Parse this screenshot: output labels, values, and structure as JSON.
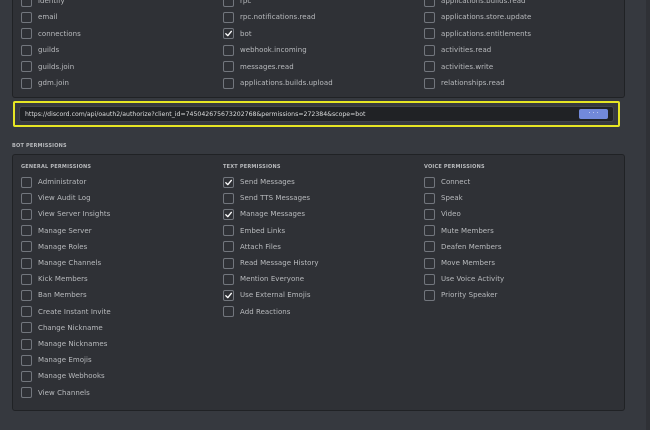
{
  "scopes": {
    "col1": [
      {
        "label": "identify",
        "checked": false
      },
      {
        "label": "email",
        "checked": false
      },
      {
        "label": "connections",
        "checked": false
      },
      {
        "label": "guilds",
        "checked": false
      },
      {
        "label": "guilds.join",
        "checked": false
      },
      {
        "label": "gdm.join",
        "checked": false
      }
    ],
    "col2": [
      {
        "label": "rpc",
        "checked": false
      },
      {
        "label": "rpc.notifications.read",
        "checked": false
      },
      {
        "label": "bot",
        "checked": true
      },
      {
        "label": "webhook.incoming",
        "checked": false
      },
      {
        "label": "messages.read",
        "checked": false
      },
      {
        "label": "applications.builds.upload",
        "checked": false
      }
    ],
    "col3": [
      {
        "label": "applications.builds.read",
        "checked": false
      },
      {
        "label": "applications.store.update",
        "checked": false
      },
      {
        "label": "applications.entitlements",
        "checked": false
      },
      {
        "label": "activities.read",
        "checked": false
      },
      {
        "label": "activities.write",
        "checked": false
      },
      {
        "label": "relationships.read",
        "checked": false
      }
    ]
  },
  "url": {
    "value": "https://discord.com/api/oauth2/authorize?client_id=745042675673202768&permissions=272384&scope=bot",
    "copy_label": "· · ·"
  },
  "bot_permissions": {
    "title": "BOT PERMISSIONS",
    "general": {
      "heading": "GENERAL PERMISSIONS",
      "items": [
        {
          "label": "Administrator",
          "checked": false
        },
        {
          "label": "View Audit Log",
          "checked": false
        },
        {
          "label": "View Server Insights",
          "checked": false
        },
        {
          "label": "Manage Server",
          "checked": false
        },
        {
          "label": "Manage Roles",
          "checked": false
        },
        {
          "label": "Manage Channels",
          "checked": false
        },
        {
          "label": "Kick Members",
          "checked": false
        },
        {
          "label": "Ban Members",
          "checked": false
        },
        {
          "label": "Create Instant Invite",
          "checked": false
        },
        {
          "label": "Change Nickname",
          "checked": false
        },
        {
          "label": "Manage Nicknames",
          "checked": false
        },
        {
          "label": "Manage Emojis",
          "checked": false
        },
        {
          "label": "Manage Webhooks",
          "checked": false
        },
        {
          "label": "View Channels",
          "checked": false
        }
      ]
    },
    "text": {
      "heading": "TEXT PERMISSIONS",
      "items": [
        {
          "label": "Send Messages",
          "checked": true
        },
        {
          "label": "Send TTS Messages",
          "checked": false
        },
        {
          "label": "Manage Messages",
          "checked": true
        },
        {
          "label": "Embed Links",
          "checked": false
        },
        {
          "label": "Attach Files",
          "checked": false
        },
        {
          "label": "Read Message History",
          "checked": false
        },
        {
          "label": "Mention Everyone",
          "checked": false
        },
        {
          "label": "Use External Emojis",
          "checked": true
        },
        {
          "label": "Add Reactions",
          "checked": false
        }
      ]
    },
    "voice": {
      "heading": "VOICE PERMISSIONS",
      "items": [
        {
          "label": "Connect",
          "checked": false
        },
        {
          "label": "Speak",
          "checked": false
        },
        {
          "label": "Video",
          "checked": false
        },
        {
          "label": "Mute Members",
          "checked": false
        },
        {
          "label": "Deafen Members",
          "checked": false
        },
        {
          "label": "Move Members",
          "checked": false
        },
        {
          "label": "Use Voice Activity",
          "checked": false
        },
        {
          "label": "Priority Speaker",
          "checked": false
        }
      ]
    }
  },
  "colors": {
    "background": "#36393f",
    "panel": "#2f3136",
    "highlight": "#e6e624",
    "accent": "#7289da"
  }
}
